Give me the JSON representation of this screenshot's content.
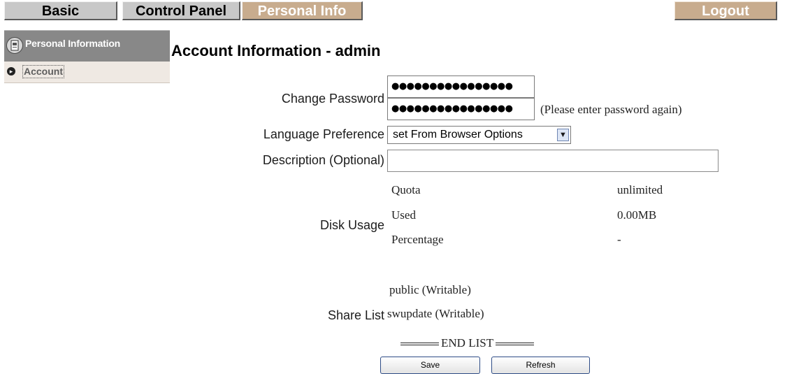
{
  "tabs": {
    "basic": "Basic",
    "control_panel": "Control Panel",
    "personal_info": "Personal Info",
    "logout": "Logout"
  },
  "sidebar": {
    "section_title": "Personal Information",
    "items": [
      {
        "label": "Account",
        "selected": true
      }
    ]
  },
  "page": {
    "title": "Account Information - admin"
  },
  "form": {
    "change_password": {
      "label": "Change Password",
      "password_mask": "●●●●●●●●●●●●●●●●",
      "confirm_mask": "●●●●●●●●●●●●●●●●",
      "note": "(Please enter password again)"
    },
    "language": {
      "label": "Language Preference",
      "selected": "set From Browser Options"
    },
    "description": {
      "label": "Description (Optional)",
      "value": ""
    },
    "disk_usage": {
      "label": "Disk Usage",
      "rows": [
        {
          "name": "Quota",
          "value": "unlimited"
        },
        {
          "name": "Used",
          "value": "0.00MB"
        },
        {
          "name": "Percentage",
          "value": "-"
        }
      ]
    },
    "share_list": {
      "label": "Share List",
      "items": [
        "public (Writable)",
        "swupdate (Writable)"
      ],
      "end_marker": "END LIST"
    }
  },
  "buttons": {
    "save": "Save",
    "refresh": "Refresh"
  },
  "colors": {
    "tab_inactive": "#c8c8c8",
    "tab_active": "#c8ac8e",
    "sidebar_header": "#888888",
    "sidebar_item_bg": "#efe9e3",
    "button_border": "#2e4c86"
  }
}
